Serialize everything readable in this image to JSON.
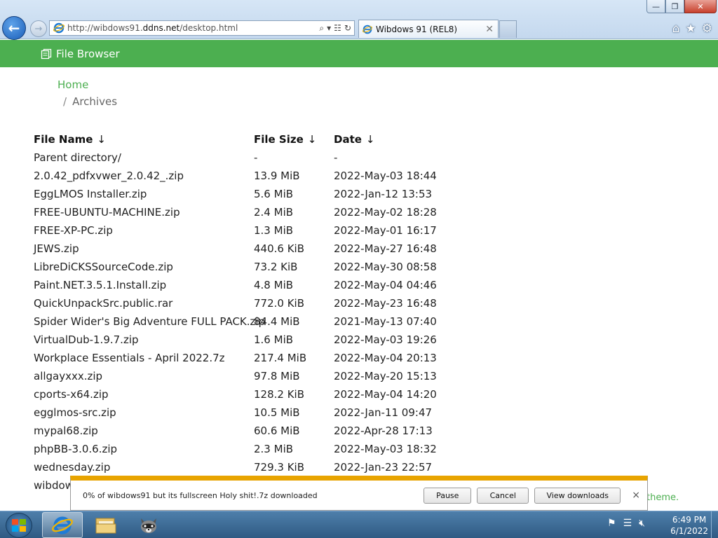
{
  "browser": {
    "url_prefix": "http://wibdows91.",
    "url_domain": "ddns.net",
    "url_path": "/desktop.html",
    "tab_title": "Wibdows 91 (REL8)",
    "controls": {
      "minimize": "—",
      "restore": "❐",
      "close": "✕"
    },
    "icons": [
      "home-icon",
      "star-icon",
      "gear-icon"
    ]
  },
  "header": {
    "title": "File Browser"
  },
  "breadcrumb": {
    "home": "Home",
    "separator": "/",
    "current": "Archives"
  },
  "table": {
    "headers": {
      "name": "File Name",
      "size": "File Size",
      "date": "Date",
      "sort_arrow": "↓"
    },
    "rows": [
      {
        "name": "Parent directory/",
        "size": "-",
        "date": "-"
      },
      {
        "name": "2.0.42_pdfxvwer_2.0.42_.zip",
        "size": "13.9 MiB",
        "date": "2022-May-03 18:44"
      },
      {
        "name": "EggLMOS Installer.zip",
        "size": "5.6 MiB",
        "date": "2022-Jan-12 13:53"
      },
      {
        "name": "FREE-UBUNTU-MACHINE.zip",
        "size": "2.4 MiB",
        "date": "2022-May-02 18:28"
      },
      {
        "name": "FREE-XP-PC.zip",
        "size": "1.3 MiB",
        "date": "2022-May-01 16:17"
      },
      {
        "name": "JEWS.zip",
        "size": "440.6 KiB",
        "date": "2022-May-27 16:48"
      },
      {
        "name": "LibreDiCKSSourceCode.zip",
        "size": "73.2 KiB",
        "date": "2022-May-30 08:58"
      },
      {
        "name": "Paint.NET.3.5.1.Install.zip",
        "size": "4.8 MiB",
        "date": "2022-May-04 04:46"
      },
      {
        "name": "QuickUnpackSrc.public.rar",
        "size": "772.0 KiB",
        "date": "2022-May-23 16:48"
      },
      {
        "name": "Spider Wider's Big Adventure FULL PACK.zip",
        "size": "84.4 MiB",
        "date": "2021-May-13 07:40"
      },
      {
        "name": "VirtualDub-1.9.7.zip",
        "size": "1.6 MiB",
        "date": "2022-May-03 19:26"
      },
      {
        "name": "Workplace Essentials - April 2022.7z",
        "size": "217.4 MiB",
        "date": "2022-May-04 20:13"
      },
      {
        "name": "allgayxxx.zip",
        "size": "97.8 MiB",
        "date": "2022-May-20 15:13"
      },
      {
        "name": "cports-x64.zip",
        "size": "128.2 KiB",
        "date": "2022-May-04 14:20"
      },
      {
        "name": "egglmos-src.zip",
        "size": "10.5 MiB",
        "date": "2022-Jan-11 09:47"
      },
      {
        "name": "mypal68.zip",
        "size": "60.6 MiB",
        "date": "2022-Apr-28 17:13"
      },
      {
        "name": "phpBB-3.0.6.zip",
        "size": "2.3 MiB",
        "date": "2022-May-03 18:32"
      },
      {
        "name": "wednesday.zip",
        "size": "729.3 KiB",
        "date": "2022-Jan-23 22:57"
      },
      {
        "name": "wibdow",
        "size": "",
        "date": ""
      }
    ]
  },
  "footer_fragment": "theme.",
  "download": {
    "message": "0% of wibdows91 but its fullscreen Holy shit!.7z downloaded",
    "pause": "Pause",
    "cancel": "Cancel",
    "view": "View downloads",
    "close": "×",
    "accent": "#e8a400"
  },
  "taskbar": {
    "time": "6:49 PM",
    "date": "6/1/2022"
  },
  "colors": {
    "green": "#4caf50",
    "link": "#4caf50"
  }
}
